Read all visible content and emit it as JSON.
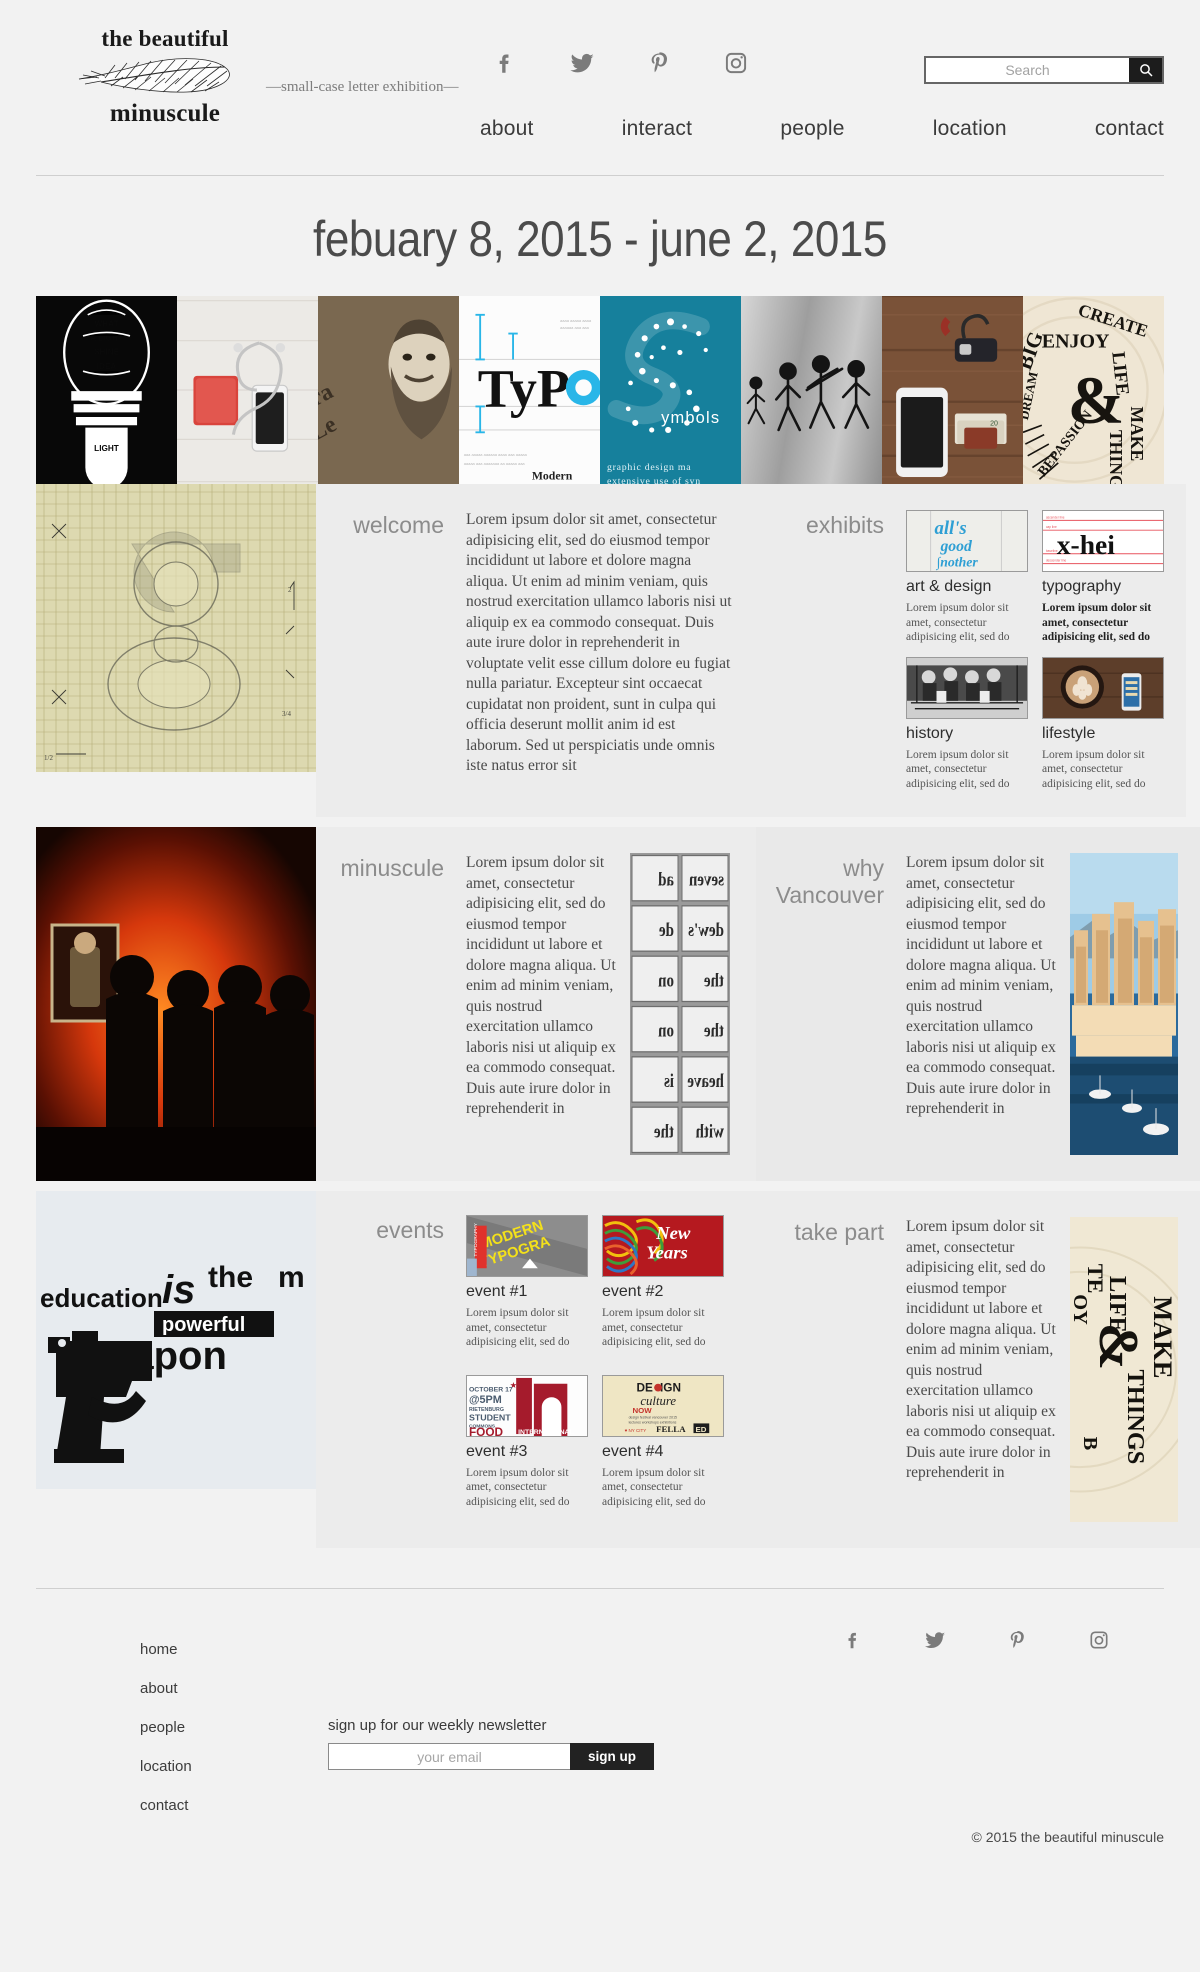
{
  "brand": {
    "line1": "the beautiful",
    "line2": "minuscule",
    "tagline": "—small-case letter exhibition—",
    "feather_icon": "feather-icon"
  },
  "header": {
    "social": [
      {
        "name": "facebook-icon",
        "label": "Facebook"
      },
      {
        "name": "twitter-icon",
        "label": "Twitter"
      },
      {
        "name": "pinterest-icon",
        "label": "Pinterest"
      },
      {
        "name": "instagram-icon",
        "label": "Instagram"
      }
    ],
    "search": {
      "placeholder": "Search",
      "value": "",
      "button_icon": "search-icon"
    },
    "nav": [
      {
        "label": "about"
      },
      {
        "label": "interact"
      },
      {
        "label": "people"
      },
      {
        "label": "location"
      },
      {
        "label": "contact"
      }
    ]
  },
  "page_title": "febuary 8, 2015 - june 2, 2015",
  "hero": [
    {
      "name": "lightbulb-typography-tile",
      "alt": "white typographic lightbulb on black"
    },
    {
      "name": "headphones-notebook-tile",
      "alt": "red notebook, phone and earbuds on white wood"
    },
    {
      "name": "letterpress-portrait-tile",
      "alt": "engraved portrait with wooden type"
    },
    {
      "name": "typo-anatomy-tile",
      "alt": "Typo letterform anatomy diagram",
      "caption": "TyPO",
      "subcaption": "Modern"
    },
    {
      "name": "symbols-poster-tile",
      "alt": "symbols poster",
      "caption": "ymbols",
      "subcaption": "graphic design ma extensive use of syn"
    },
    {
      "name": "evolution-figures-tile",
      "alt": "stick figure evolution on grey"
    },
    {
      "name": "keys-phone-wood-tile",
      "alt": "car key, phone and money clip on wood"
    },
    {
      "name": "create-enjoy-life-tile",
      "alt": "CREATE ENJOY LIFE MAKE THINGS ampersand lettering"
    }
  ],
  "sections": {
    "welcome": {
      "label": "welcome",
      "body": "Lorem ipsum dolor sit amet, consectetur adipisicing elit, sed do eiusmod tempor incididunt ut labore et dolore magna aliqua. Ut enim ad minim veniam, quis nostrud exercitation ullamco laboris nisi ut aliquip ex ea commodo consequat. Duis aute irure dolor in reprehenderit in voluptate velit esse cillum dolore eu fugiat nulla pariatur. Excepteur sint occaecat cupidatat non proident, sunt in culpa qui officia deserunt mollit anim id est laborum. Sed ut perspiciatis unde omnis iste natus error sit",
      "image": {
        "name": "letterform-blueprint-image",
        "alt": "pencil construction drawing of letter g on graph paper"
      }
    },
    "exhibits": {
      "label": "exhibits",
      "items": [
        {
          "title": "art & design",
          "desc": "Lorem ipsum dolor sit amet, consectetur adipisicing elit, sed do",
          "image": {
            "name": "alls-good-lettering-thumb",
            "alt": "blue script lettering all's good"
          },
          "bold": false
        },
        {
          "title": "typography",
          "desc": "Lorem ipsum dolor sit amet, consectetur adipisicing elit, sed do",
          "image": {
            "name": "x-height-diagram-thumb",
            "alt": "x-hei type specimen with red baselines"
          },
          "bold": true
        },
        {
          "title": "history",
          "desc": "Lorem ipsum dolor sit amet, consectetur adipisicing elit, sed do",
          "image": {
            "name": "printing-press-engraving-thumb",
            "alt": "black and white printing workshop engraving"
          },
          "bold": false
        },
        {
          "title": "lifestyle",
          "desc": "Lorem ipsum dolor sit amet, consectetur adipisicing elit, sed do",
          "image": {
            "name": "latte-phone-thumb",
            "alt": "latte art and phone on wooden table"
          },
          "bold": false
        }
      ]
    },
    "minuscule": {
      "label": "minuscule",
      "body": "Lorem ipsum dolor sit amet, consectetur adipisicing elit, sed do eiusmod tempor incididunt ut labore et dolore magna aliqua. Ut enim ad minim veniam, quis nostrud exercitation ullamco laboris nisi ut aliquip ex ea commodo consequat. Duis aute irure dolor in reprehenderit in",
      "image": {
        "name": "gallery-silhouettes-image",
        "alt": "visitors silhouetted against orange lit artwork"
      },
      "side_image": {
        "name": "metal-type-blocks-image",
        "alt": "mirrored metal letterpress type blocks"
      }
    },
    "why_vancouver": {
      "label": "why Vancouver",
      "body": "Lorem ipsum dolor sit amet, consectetur adipisicing elit, sed do eiusmod tempor incididunt ut labore et dolore magna aliqua. Ut enim ad minim veniam, quis nostrud exercitation ullamco laboris nisi ut aliquip ex ea commodo consequat. Duis aute irure dolor in reprehenderit in",
      "side_image": {
        "name": "vancouver-skyline-image",
        "alt": "Vancouver waterfront highrises at golden hour"
      }
    },
    "events": {
      "label": "events",
      "items": [
        {
          "title": "event #1",
          "desc": "Lorem ipsum dolor sit amet, consectetur adipisicing elit, sed do",
          "image": {
            "name": "modern-typography-poster-thumb",
            "alt": "MODERN TYPOGRAPHY yellow diagonal poster"
          }
        },
        {
          "title": "event #2",
          "desc": "Lorem ipsum dolor sit amet, consectetur adipisicing elit, sed do",
          "image": {
            "name": "new-years-lettering-thumb",
            "alt": "rainbow New Year's script lettering on red"
          }
        },
        {
          "title": "event #3",
          "desc": "Lorem ipsum dolor sit amet, consectetur adipisicing elit, sed do",
          "image": {
            "name": "food-international-night-thumb",
            "alt": "FOOD INTERNATIONAL NIGHT red and white poster"
          }
        },
        {
          "title": "event #4",
          "desc": "Lorem ipsum dolor sit amet, consectetur adipisicing elit, sed do",
          "image": {
            "name": "design-culture-now-thumb",
            "alt": "DESIGN culture NOW cream poster"
          }
        }
      ]
    },
    "take_part": {
      "label": "take part",
      "body": "Lorem ipsum dolor sit amet, consectetur adipisicing elit, sed do eiusmod tempor incididunt ut labore et dolore magna aliqua. Ut enim ad minim veniam, quis nostrud exercitation ullamco laboris nisi ut aliquip ex ea commodo consequat. Duis aute irure dolor in reprehenderit in",
      "image": {
        "name": "education-weapon-poster-image",
        "alt": "education is the most powerful weapon typographic gun poster"
      },
      "side_image": {
        "name": "make-things-ampersand-image",
        "alt": "CREATE ENJOY LIFE MAKE THINGS circular ampersand lettering"
      }
    }
  },
  "footer": {
    "links": [
      {
        "label": "home"
      },
      {
        "label": "about"
      },
      {
        "label": "people"
      },
      {
        "label": "location"
      },
      {
        "label": "contact"
      }
    ],
    "newsletter": {
      "label": "sign up for our weekly newsletter",
      "placeholder": "your email",
      "value": "",
      "button_label": "sign up"
    },
    "social": [
      {
        "name": "facebook-icon",
        "label": "Facebook"
      },
      {
        "name": "twitter-icon",
        "label": "Twitter"
      },
      {
        "name": "pinterest-icon",
        "label": "Pinterest"
      },
      {
        "name": "instagram-icon",
        "label": "Instagram"
      }
    ],
    "copyright": "© 2015 the beautiful minuscule"
  },
  "colors": {
    "page_bg": "#f2f2f2",
    "panel_bg": "#ececec",
    "accent_dark": "#1c1c1c",
    "muted_text": "#8c8c8c",
    "rule": "#cfcfcf"
  }
}
